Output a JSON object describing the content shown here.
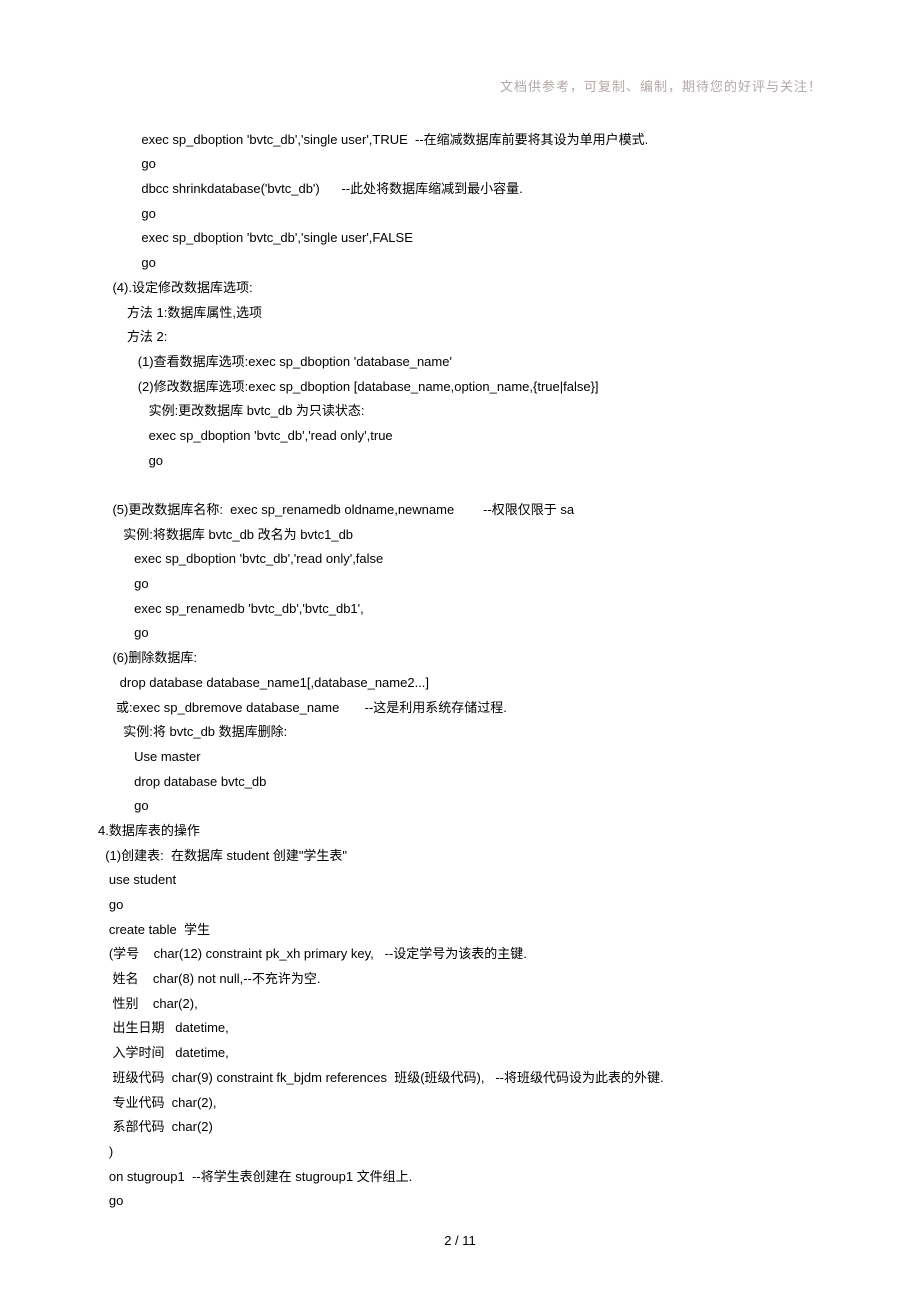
{
  "header": "文档供参考，可复制、编制，期待您的好评与关注！",
  "lines": [
    "            exec sp_dboption 'bvtc_db','single user',TRUE  --在缩减数据库前要将其设为单用户模式.",
    "            go",
    "            dbcc shrinkdatabase('bvtc_db')      --此处将数据库缩减到最小容量.",
    "            go",
    "            exec sp_dboption 'bvtc_db','single user',FALSE",
    "            go",
    "    (4).设定修改数据库选项:",
    "        方法 1:数据库属性,选项",
    "        方法 2:",
    "           (1)查看数据库选项:exec sp_dboption 'database_name'",
    "           (2)修改数据库选项:exec sp_dboption [database_name,option_name,{true|false}]",
    "              实例:更改数据库 bvtc_db 为只读状态:",
    "              exec sp_dboption 'bvtc_db','read only',true",
    "              go",
    "",
    "    (5)更改数据库名称:  exec sp_renamedb oldname,newname        --权限仅限于 sa",
    "       实例:将数据库 bvtc_db 改名为 bvtc1_db",
    "          exec sp_dboption 'bvtc_db','read only',false",
    "          go",
    "          exec sp_renamedb 'bvtc_db','bvtc_db1',",
    "          go",
    "    (6)删除数据库:",
    "      drop database database_name1[,database_name2...]",
    "     或:exec sp_dbremove database_name       --这是利用系统存储过程.",
    "       实例:将 bvtc_db 数据库删除:",
    "          Use master",
    "          drop database bvtc_db",
    "          go",
    "4.数据库表的操作",
    "  (1)创建表:  在数据库 student 创建\"学生表\"",
    "   use student",
    "   go",
    "   create table  学生",
    "   (学号    char(12) constraint pk_xh primary key,   --设定学号为该表的主键.",
    "    姓名    char(8) not null,--不充许为空.",
    "    性别    char(2),",
    "    出生日期   datetime,",
    "    入学时间   datetime,",
    "    班级代码  char(9) constraint fk_bjdm references  班级(班级代码),   --将班级代码设为此表的外键.",
    "    专业代码  char(2),",
    "    系部代码  char(2)",
    "   )",
    "   on stugroup1  --将学生表创建在 stugroup1 文件组上.",
    "   go"
  ],
  "pageNumber": "2  /  11"
}
